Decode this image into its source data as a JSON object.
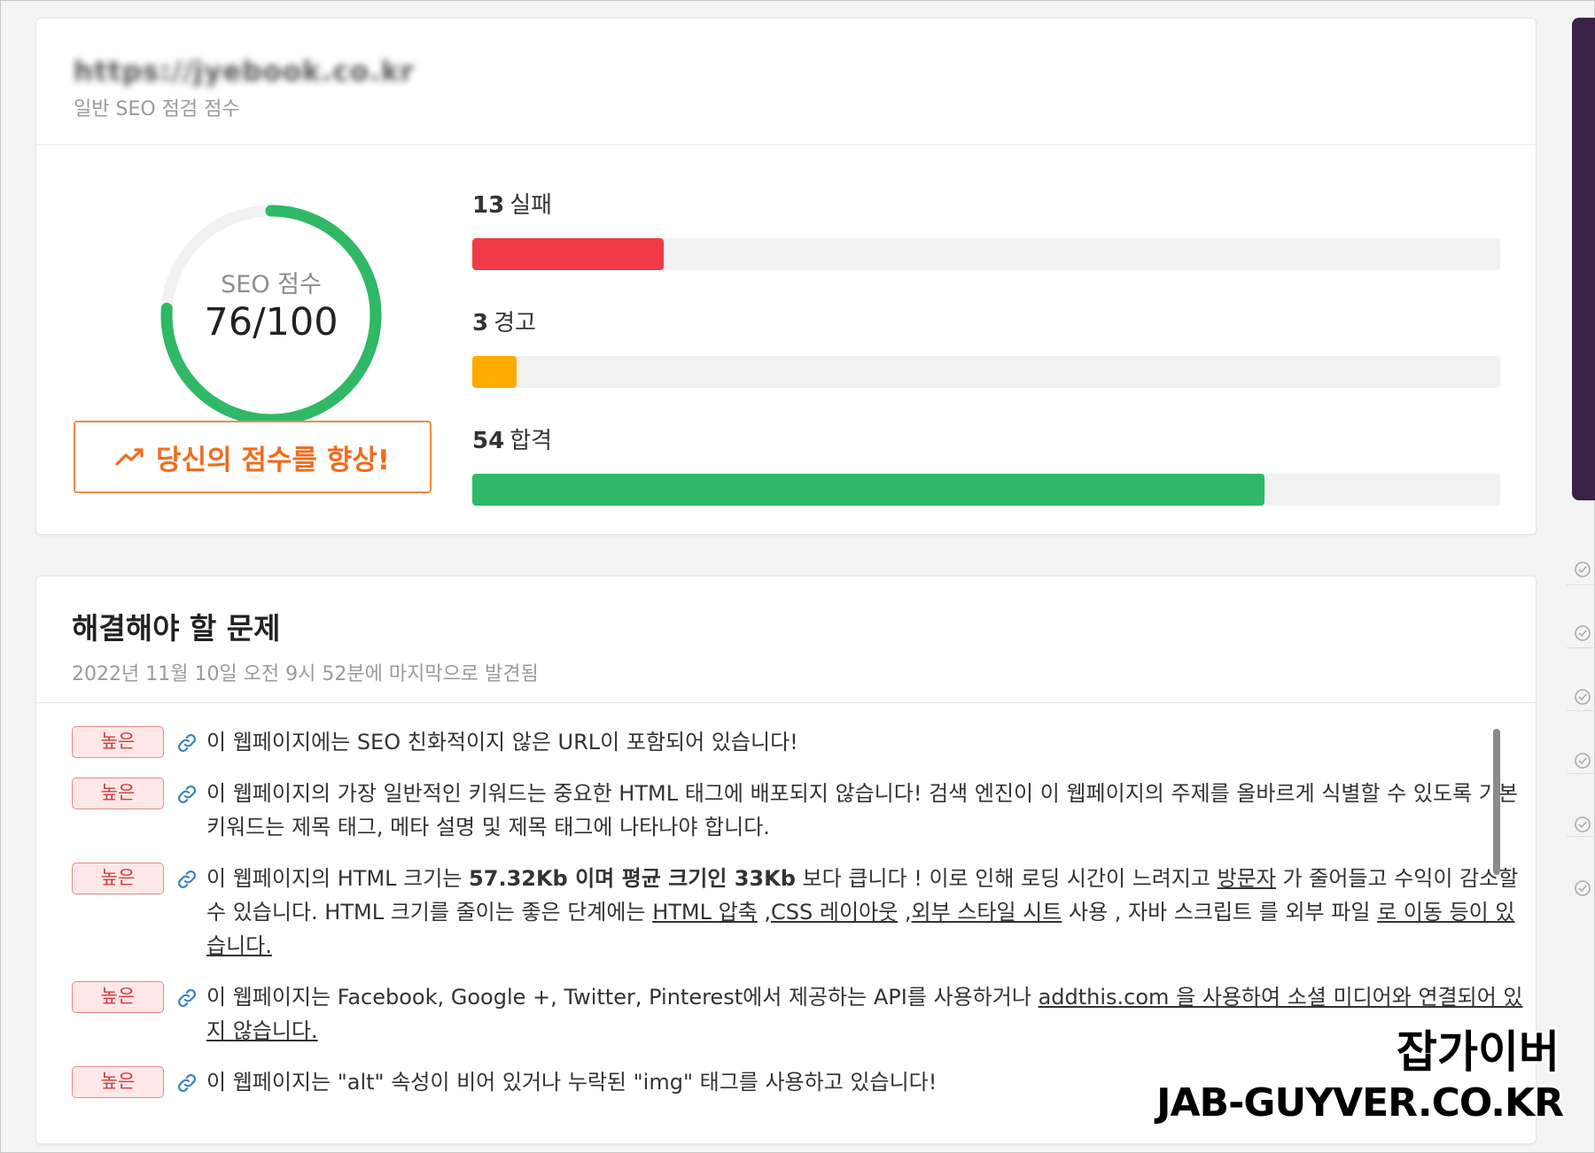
{
  "header": {
    "url_blurred": "https://jyebook.co.kr",
    "subtitle": "일반 SEO 점검 점수"
  },
  "score": {
    "label": "SEO 점수",
    "value_text": "76/100",
    "value": 76,
    "max": 100,
    "color": "#2fb866"
  },
  "improve_button": {
    "label": "당신의 점수를 향상!",
    "icon": "trending-up-icon",
    "color": "#f26b1d"
  },
  "stats": [
    {
      "count": "13",
      "label": "실패",
      "value": 13,
      "fraction": 0.186,
      "color": "#f23a48"
    },
    {
      "count": "3",
      "label": "경고",
      "value": 3,
      "fraction": 0.043,
      "color": "#ffaa00"
    },
    {
      "count": "54",
      "label": "합격",
      "value": 54,
      "fraction": 0.771,
      "color": "#2fb866"
    }
  ],
  "issues": {
    "title": "해결해야 할 문제",
    "date": "2022년 11월 10일 오전 9시 52분에 마지막으로 발견됨",
    "items": [
      {
        "badge": "높은",
        "text": "이 웹페이지에는 SEO 친화적이지 않은 URL이 포함되어 있습니다!"
      },
      {
        "badge": "높은",
        "text": "이 웹페이지의 가장 일반적인 키워드는 중요한 HTML 태그에 배포되지 않습니다! 검색 엔진이 이 웹페이지의 주제를 올바르게 식별할 수 있도록 기본 키워드는 제목 태그, 메타 설명 및 제목 태그에 나타나야 합니다."
      },
      {
        "badge": "높은",
        "p1": "이 웹페이지의 HTML 크기는",
        "p2": "57.32Kb 이며 평균 크기인 33Kb",
        "p3": "보다 큽니다 ! 이로 인해 로딩 시간이 느려지고",
        "l1": "방문자",
        "p4": "가 줄어들고 수익이 감소할 수 있습니다. HTML 크기를 줄이는 좋은 단계에는",
        "l2": "HTML 압축",
        "p5": ",",
        "l3": "CSS 레이아웃",
        "p6": ",",
        "l4": "외부 스타일 시트",
        "p7": "사용 , 자바 스크립트 를 외부 파일",
        "l5": "로 이동 등이 있습니다."
      },
      {
        "badge": "높은",
        "p1": "이 웹페이지는 Facebook, Google +, Twitter, Pinterest에서 제공하는 API를 사용하거나",
        "l1": "addthis.com 을 사용하여 소셜 미디어와 연결되어 있지 않습니다."
      },
      {
        "badge": "높은",
        "text": "이 웹페이지는 \"alt\" 속성이 비어 있거나 누락된 \"img\" 태그를 사용하고 있습니다!"
      }
    ]
  },
  "watermark": {
    "line1": "잡가이버",
    "line2": "JAB-GUYVER.CO.KR"
  }
}
